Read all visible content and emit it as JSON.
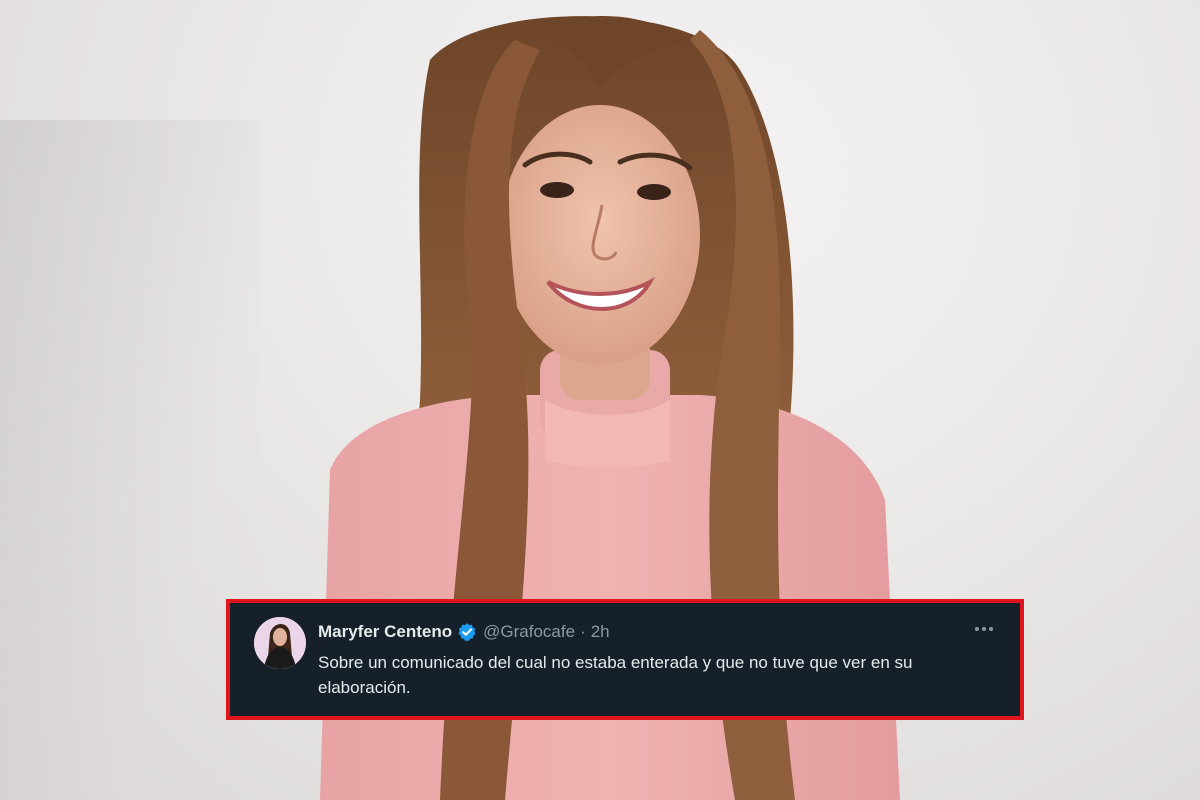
{
  "tweet": {
    "display_name": "Maryfer Centeno",
    "handle": "@Grafocafe",
    "separator": "·",
    "timestamp": "2h",
    "text": "Sobre un comunicado del cual no estaba enterada y que no tuve que ver en su elaboración."
  },
  "icons": {
    "verified": "verified-badge-icon",
    "more": "more-options-icon"
  },
  "colors": {
    "highlight_border": "#e0161e",
    "tweet_background": "#15202b",
    "verified_blue": "#1d9bf0",
    "primary_text": "#e7e9ea",
    "secondary_text": "#8b98a5",
    "sweater_pink": "#e9a7a9",
    "hair_brown": "#8a5a38"
  }
}
